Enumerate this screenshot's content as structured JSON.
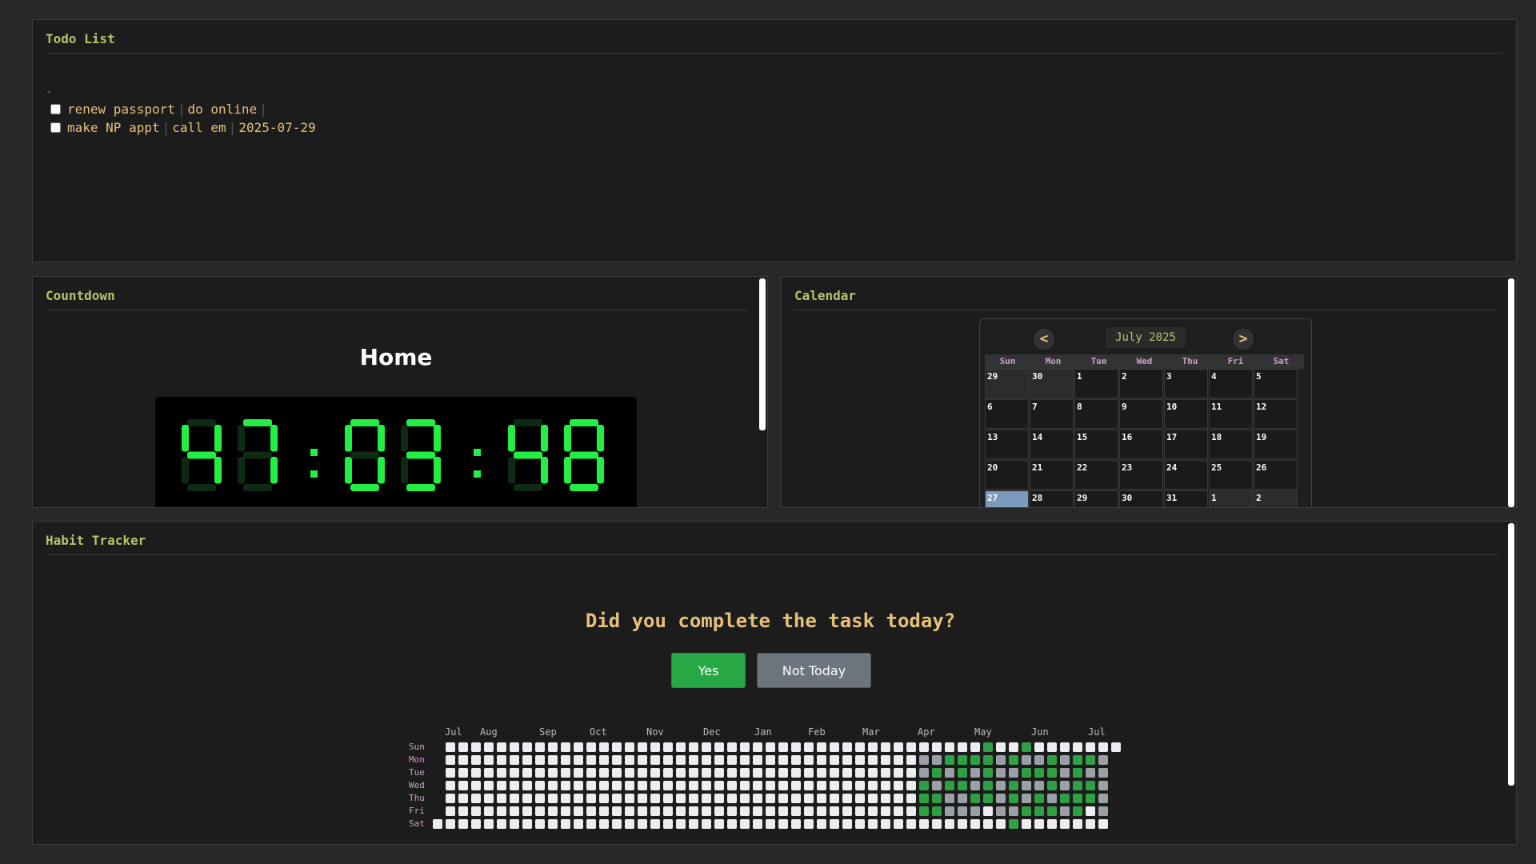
{
  "todo": {
    "title": "Todo List",
    "dot": "-",
    "items": [
      {
        "task": "renew passport",
        "note": "do online",
        "due": ""
      },
      {
        "task": "make NP appt",
        "note": "call em",
        "due": "2025-07-29"
      }
    ]
  },
  "countdown": {
    "title": "Countdown",
    "name": "Home",
    "time": "47:03:48",
    "digit_color": "#22ee44"
  },
  "calendar": {
    "title": "Calendar",
    "month_label": "July 2025",
    "prev_label": "<",
    "next_label": ">",
    "weekdays": [
      "Sun",
      "Mon",
      "Tue",
      "Wed",
      "Thu",
      "Fri",
      "Sat"
    ],
    "weeks": [
      [
        {
          "d": "29",
          "o": true
        },
        {
          "d": "30",
          "o": true
        },
        {
          "d": "1"
        },
        {
          "d": "2"
        },
        {
          "d": "3"
        },
        {
          "d": "4"
        },
        {
          "d": "5"
        }
      ],
      [
        {
          "d": "6"
        },
        {
          "d": "7"
        },
        {
          "d": "8"
        },
        {
          "d": "9"
        },
        {
          "d": "10"
        },
        {
          "d": "11"
        },
        {
          "d": "12"
        }
      ],
      [
        {
          "d": "13"
        },
        {
          "d": "14"
        },
        {
          "d": "15"
        },
        {
          "d": "16"
        },
        {
          "d": "17"
        },
        {
          "d": "18"
        },
        {
          "d": "19"
        }
      ],
      [
        {
          "d": "20"
        },
        {
          "d": "21"
        },
        {
          "d": "22"
        },
        {
          "d": "23"
        },
        {
          "d": "24"
        },
        {
          "d": "25"
        },
        {
          "d": "26"
        }
      ],
      [
        {
          "d": "27",
          "t": true
        },
        {
          "d": "28"
        },
        {
          "d": "29"
        },
        {
          "d": "30"
        },
        {
          "d": "31"
        },
        {
          "d": "1",
          "o": true
        },
        {
          "d": "2",
          "o": true
        }
      ]
    ]
  },
  "habit": {
    "title": "Habit Tracker",
    "question": "Did you complete the task today?",
    "yes_label": "Yes",
    "no_label": "Not Today",
    "months": [
      "Jul",
      "Aug",
      "Sep",
      "Oct",
      "Nov",
      "Dec",
      "Jan",
      "Feb",
      "Mar",
      "Apr",
      "May",
      "Jun",
      "Jul"
    ],
    "days": [
      "Sun",
      "Mon",
      "Tue",
      "Wed",
      "Thu",
      "Fri",
      "Sat"
    ],
    "colors": {
      "empty": "#ebedf0",
      "done": "#2ea043",
      "skipped": "#9aa0a6"
    },
    "recent_weeks": [
      "..x.x..",
      ".xxxx..",
      ".....x.",
      "..x....",
      ".x.....",
      "x......"
    ]
  }
}
